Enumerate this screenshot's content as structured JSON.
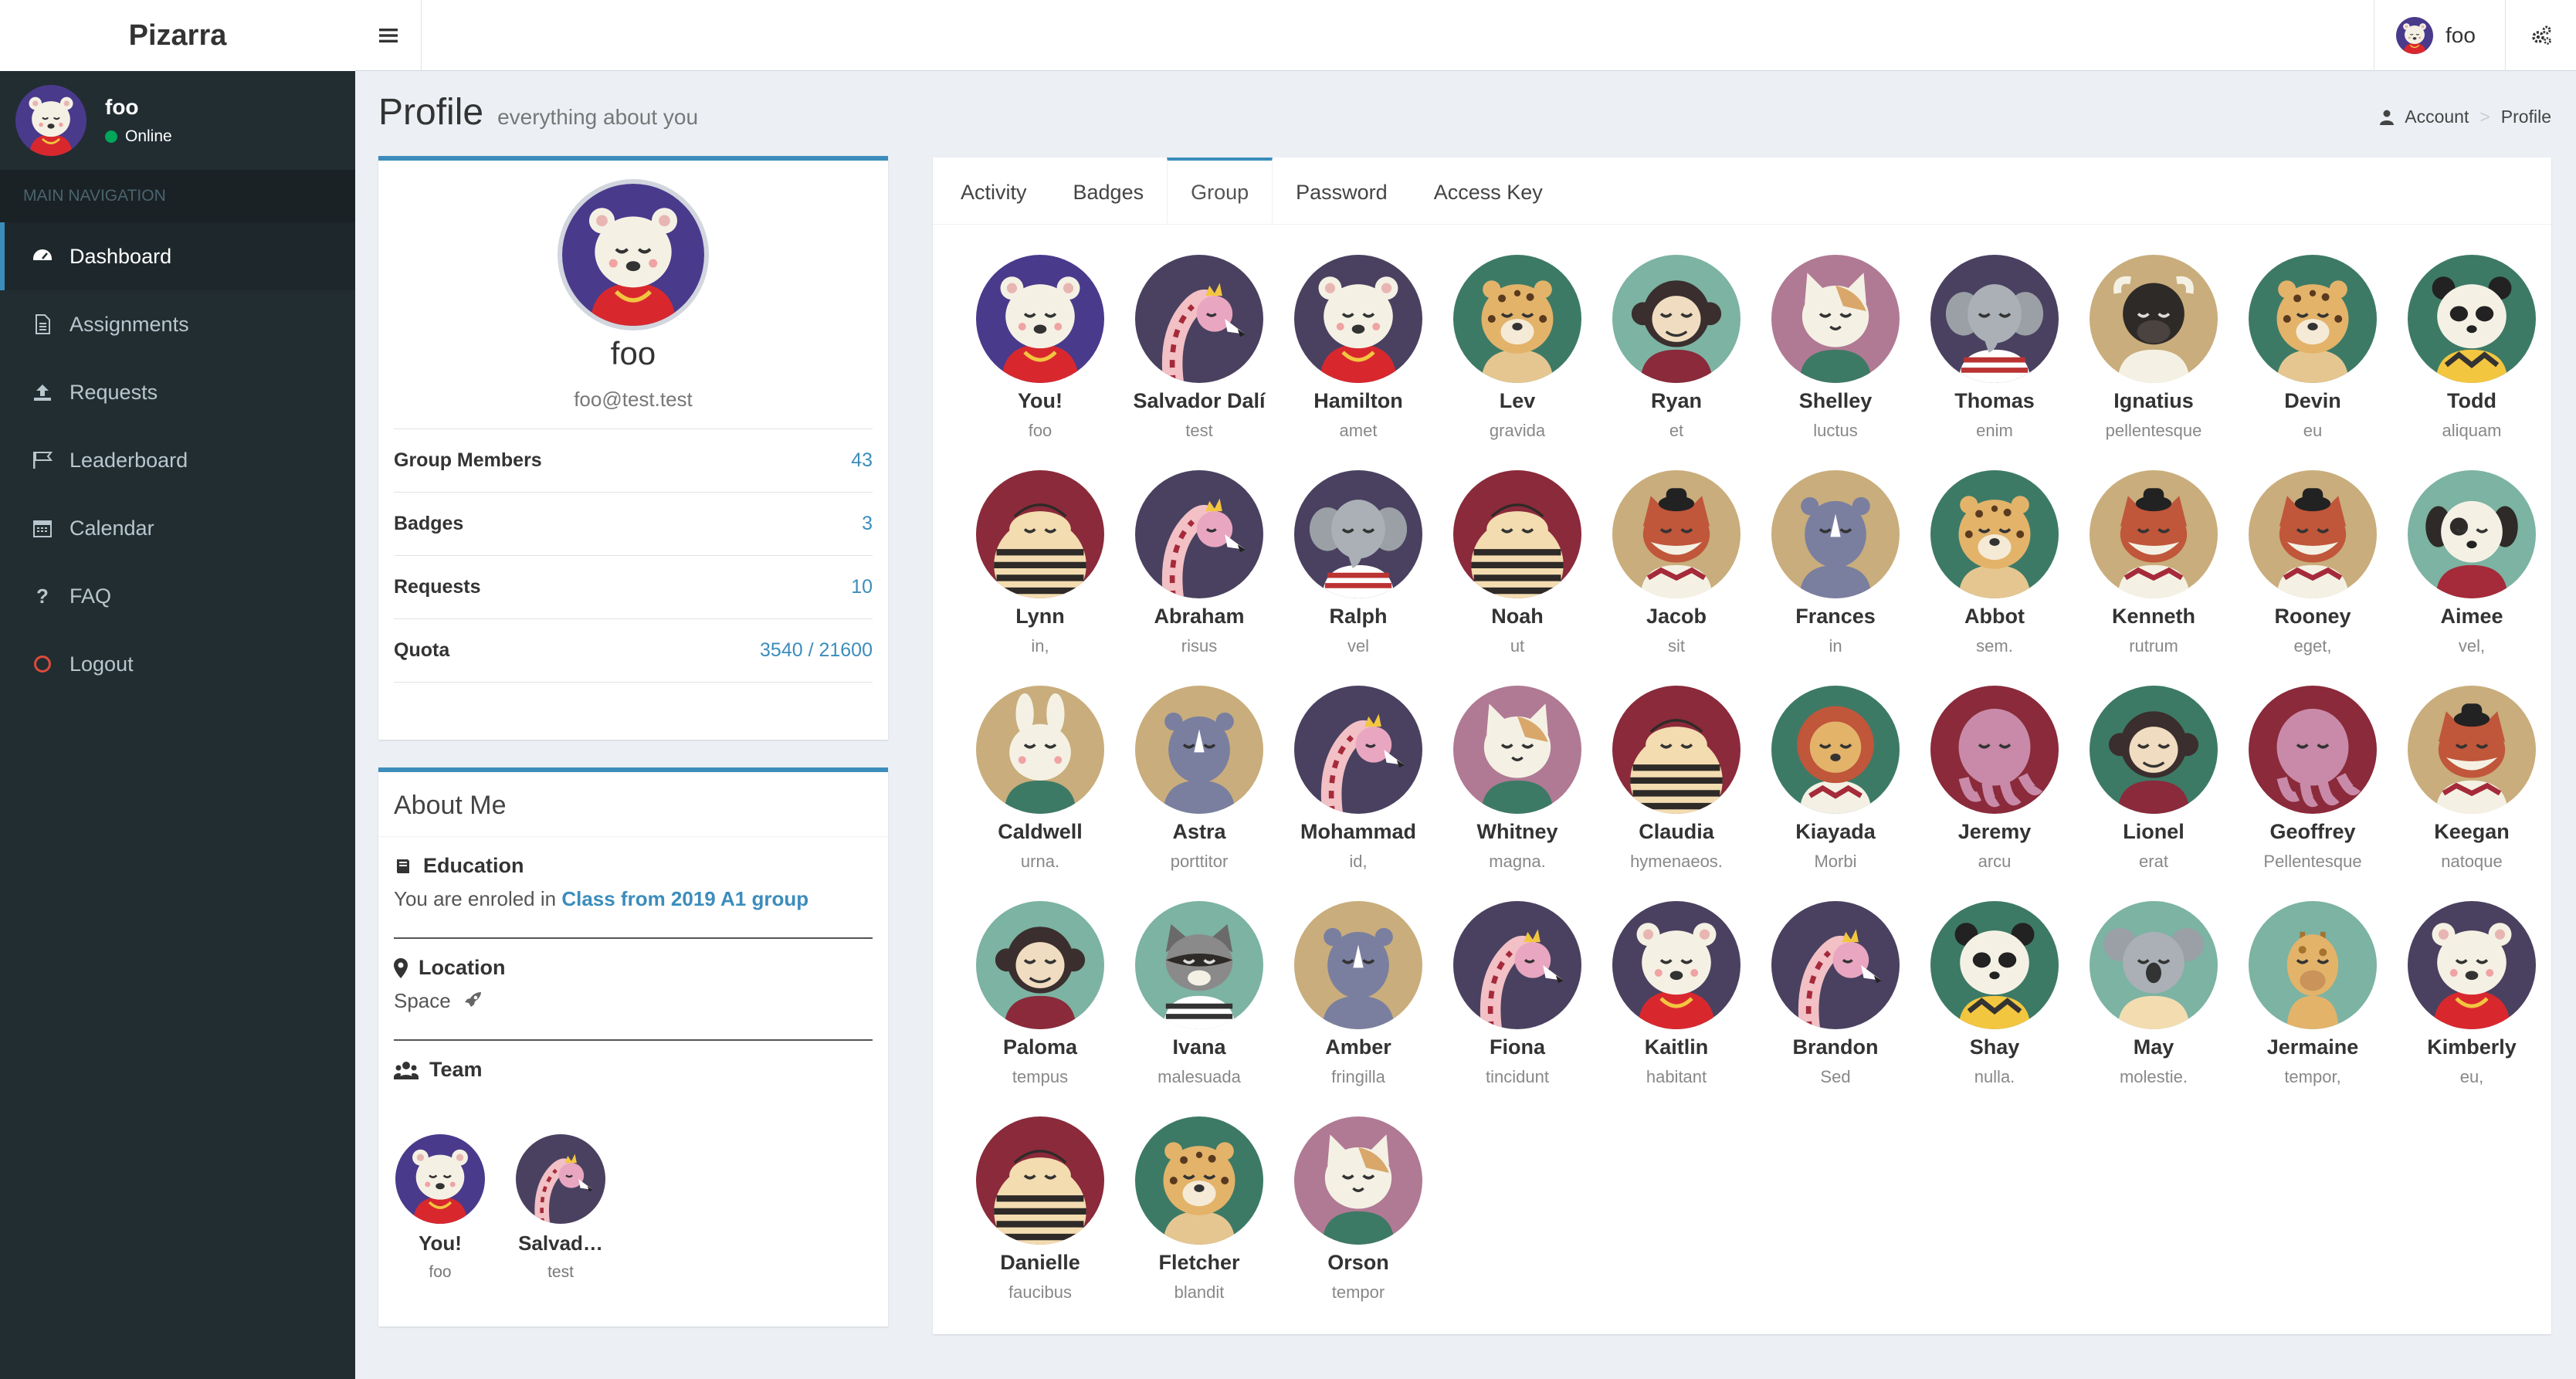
{
  "app": {
    "name": "Pizarra"
  },
  "header": {
    "user_name": "foo"
  },
  "sidebar": {
    "user_name": "foo",
    "status": "Online",
    "nav_header": "MAIN NAVIGATION",
    "items": [
      {
        "label": "Dashboard",
        "icon": "dashboard-icon"
      },
      {
        "label": "Assignments",
        "icon": "document-icon"
      },
      {
        "label": "Requests",
        "icon": "upload-icon"
      },
      {
        "label": "Leaderboard",
        "icon": "flag-icon"
      },
      {
        "label": "Calendar",
        "icon": "calendar-icon"
      },
      {
        "label": "FAQ",
        "icon": "question-icon"
      },
      {
        "label": "Logout",
        "icon": "power-icon"
      }
    ]
  },
  "page": {
    "title": "Profile",
    "subtitle": "everything about you"
  },
  "breadcrumb": {
    "account": "Account",
    "profile": "Profile"
  },
  "profile": {
    "name": "foo",
    "email": "foo@test.test",
    "stats": [
      {
        "label": "Group Members",
        "value": "43"
      },
      {
        "label": "Badges",
        "value": "3"
      },
      {
        "label": "Requests",
        "value": "10"
      },
      {
        "label": "Quota",
        "value": "3540 / 21600"
      }
    ]
  },
  "about": {
    "title": "About Me",
    "education": {
      "label": "Education",
      "prefix": "You are enroled in ",
      "link": "Class from 2019 A1 group"
    },
    "location": {
      "label": "Location",
      "value": "Space"
    },
    "team": {
      "label": "Team",
      "members": [
        {
          "name": "You!",
          "sub": "foo",
          "animal": "bear",
          "bg": "#4a3a8c"
        },
        {
          "name": "Salvad…",
          "sub": "test",
          "animal": "flamingo",
          "bg": "#4a4160"
        }
      ]
    }
  },
  "tabs": [
    "Activity",
    "Badges",
    "Group",
    "Password",
    "Access Key"
  ],
  "active_tab": "Group",
  "group_members": [
    {
      "name": "You!",
      "sub": "foo",
      "animal": "bear",
      "bg": "#4a3a8c"
    },
    {
      "name": "Salvador Dalí",
      "sub": "test",
      "animal": "flamingo",
      "bg": "#4a4160"
    },
    {
      "name": "Hamilton",
      "sub": "amet",
      "animal": "bear",
      "bg": "#4a4160"
    },
    {
      "name": "Lev",
      "sub": "gravida",
      "animal": "leopard",
      "bg": "#3d7a66"
    },
    {
      "name": "Ryan",
      "sub": "et",
      "animal": "monkey",
      "bg": "#7cb3a3"
    },
    {
      "name": "Shelley",
      "sub": "luctus",
      "animal": "cat",
      "bg": "#b07a94"
    },
    {
      "name": "Thomas",
      "sub": "enim",
      "animal": "elephant",
      "bg": "#4a4160"
    },
    {
      "name": "Ignatius",
      "sub": "pellentesque",
      "animal": "buffalo",
      "bg": "#c9ad7c"
    },
    {
      "name": "Devin",
      "sub": "eu",
      "animal": "leopard",
      "bg": "#3d7a66"
    },
    {
      "name": "Todd",
      "sub": "aliquam",
      "animal": "panda",
      "bg": "#3d7a66"
    },
    {
      "name": "Lynn",
      "sub": "in,",
      "animal": "bee",
      "bg": "#8a2a3a"
    },
    {
      "name": "Abraham",
      "sub": "risus",
      "animal": "flamingo",
      "bg": "#4a4160"
    },
    {
      "name": "Ralph",
      "sub": "vel",
      "animal": "elephant",
      "bg": "#4a4160"
    },
    {
      "name": "Noah",
      "sub": "ut",
      "animal": "bee",
      "bg": "#8a2a3a"
    },
    {
      "name": "Jacob",
      "sub": "sit",
      "animal": "fox",
      "bg": "#c9ad7c"
    },
    {
      "name": "Frances",
      "sub": "in",
      "animal": "rhino",
      "bg": "#c9ad7c"
    },
    {
      "name": "Abbot",
      "sub": "sem.",
      "animal": "leopard",
      "bg": "#3d7a66"
    },
    {
      "name": "Kenneth",
      "sub": "rutrum",
      "animal": "fox",
      "bg": "#c9ad7c"
    },
    {
      "name": "Rooney",
      "sub": "eget,",
      "animal": "fox",
      "bg": "#c9ad7c"
    },
    {
      "name": "Aimee",
      "sub": "vel,",
      "animal": "dog",
      "bg": "#7cb3a3"
    },
    {
      "name": "Caldwell",
      "sub": "urna.",
      "animal": "rabbit",
      "bg": "#c9ad7c"
    },
    {
      "name": "Astra",
      "sub": "porttitor",
      "animal": "rhino",
      "bg": "#c9ad7c"
    },
    {
      "name": "Mohammad",
      "sub": "id,",
      "animal": "flamingo",
      "bg": "#4a4160"
    },
    {
      "name": "Whitney",
      "sub": "magna.",
      "animal": "cat",
      "bg": "#b07a94"
    },
    {
      "name": "Claudia",
      "sub": "hymenaeos.",
      "animal": "bee",
      "bg": "#8a2a3a"
    },
    {
      "name": "Kiayada",
      "sub": "Morbi",
      "animal": "lion",
      "bg": "#3d7a66"
    },
    {
      "name": "Jeremy",
      "sub": "arcu",
      "animal": "octopus",
      "bg": "#8a2a3a"
    },
    {
      "name": "Lionel",
      "sub": "erat",
      "animal": "monkey",
      "bg": "#3d7a66"
    },
    {
      "name": "Geoffrey",
      "sub": "Pellentesque",
      "animal": "octopus",
      "bg": "#8a2a3a"
    },
    {
      "name": "Keegan",
      "sub": "natoque",
      "animal": "fox",
      "bg": "#c9ad7c"
    },
    {
      "name": "Paloma",
      "sub": "tempus",
      "animal": "monkey",
      "bg": "#7cb3a3"
    },
    {
      "name": "Ivana",
      "sub": "malesuada",
      "animal": "raccoon",
      "bg": "#7cb3a3"
    },
    {
      "name": "Amber",
      "sub": "fringilla",
      "animal": "rhino",
      "bg": "#c9ad7c"
    },
    {
      "name": "Fiona",
      "sub": "tincidunt",
      "animal": "flamingo",
      "bg": "#4a4160"
    },
    {
      "name": "Kaitlin",
      "sub": "habitant",
      "animal": "bear",
      "bg": "#4a4160"
    },
    {
      "name": "Brandon",
      "sub": "Sed",
      "animal": "flamingo",
      "bg": "#4a4160"
    },
    {
      "name": "Shay",
      "sub": "nulla.",
      "animal": "panda",
      "bg": "#3d7a66"
    },
    {
      "name": "May",
      "sub": "molestie.",
      "animal": "koala",
      "bg": "#7cb3a3"
    },
    {
      "name": "Jermaine",
      "sub": "tempor,",
      "animal": "giraffe",
      "bg": "#7cb3a3"
    },
    {
      "name": "Kimberly",
      "sub": "eu,",
      "animal": "bear",
      "bg": "#4a4160"
    },
    {
      "name": "Danielle",
      "sub": "faucibus",
      "animal": "bee",
      "bg": "#8a2a3a"
    },
    {
      "name": "Fletcher",
      "sub": "blandit",
      "animal": "leopard",
      "bg": "#3d7a66"
    },
    {
      "name": "Orson",
      "sub": "tempor",
      "animal": "cat",
      "bg": "#b07a94"
    }
  ],
  "colors": {
    "accent": "#3c8dbc",
    "sidebar": "#222d32",
    "online": "#00a65a",
    "logout": "#dd4b39"
  }
}
